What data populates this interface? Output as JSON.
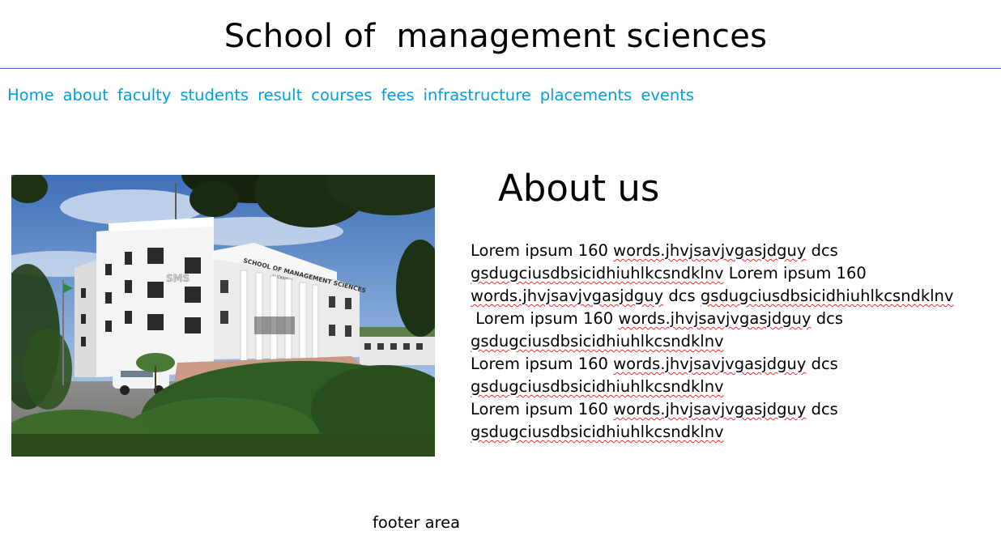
{
  "header": {
    "title": "School of  management sciences"
  },
  "nav": {
    "items": [
      {
        "label": "Home",
        "name": "home"
      },
      {
        "label": "about",
        "name": "about"
      },
      {
        "label": "faculty",
        "name": "faculty"
      },
      {
        "label": "students",
        "name": "students"
      },
      {
        "label": "result",
        "name": "result"
      },
      {
        "label": "courses",
        "name": "courses"
      },
      {
        "label": "fees",
        "name": "fees"
      },
      {
        "label": "infrastructure",
        "name": "infrastructure"
      },
      {
        "label": "placements",
        "name": "placements"
      },
      {
        "label": "events",
        "name": "events"
      }
    ]
  },
  "photo": {
    "building_sign": "SCHOOL OF MANAGEMENT SCIENCES",
    "building_sign_sub": "LUCKNOW",
    "building_logo": "SMS"
  },
  "about": {
    "heading": "About us",
    "paragraphs": [
      {
        "a": "Lorem ipsum 160 ",
        "b": "words.jhvjsavjvgasjdguy",
        "c": " dcs",
        "d": "gsdugciusdbsicidhiuhlkcsndklnv",
        "e": " Lorem ipsum 160"
      },
      {
        "a": "",
        "b": "words.jhvjsavjvgasjdguy",
        "c": " dcs ",
        "d": "gsdugciusdbsicidhiuhlkcsndklnv",
        "e": ""
      },
      {
        "a": " Lorem ipsum 160 ",
        "b": "words.jhvjsavjvgasjdguy",
        "c": " dcs",
        "d": "gsdugciusdbsicidhiuhlkcsndklnv",
        "e": ""
      },
      {
        "a": "Lorem ipsum 160 ",
        "b": "words.jhvjsavjvgasjdguy",
        "c": " dcs",
        "d": "gsdugciusdbsicidhiuhlkcsndklnv",
        "e": ""
      },
      {
        "a": "Lorem ipsum 160 ",
        "b": "words.jhvjsavjvgasjdguy",
        "c": " dcs",
        "d": "gsdugciusdbsicidhiuhlkcsndklnv",
        "e": ""
      }
    ]
  },
  "footer": {
    "text": "footer area"
  },
  "colors": {
    "nav_link": "#00a0e0",
    "rule": "#4472c4",
    "spellcheck": "#e03030"
  }
}
